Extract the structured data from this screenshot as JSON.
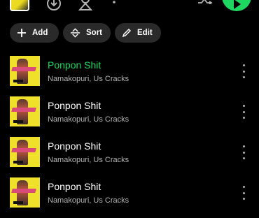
{
  "chips": {
    "add_label": "Add",
    "sort_label": "Sort",
    "edit_label": "Edit"
  },
  "tracks": [
    {
      "title": "Ponpon Shit",
      "artist": "Namakopuri, Us Cracks",
      "playing": true
    },
    {
      "title": "Ponpon Shit",
      "artist": "Namakopuri, Us Cracks",
      "playing": false
    },
    {
      "title": "Ponpon Shit",
      "artist": "Namakopuri, Us Cracks",
      "playing": false
    },
    {
      "title": "Ponpon Shit",
      "artist": "Namakopuri, Us Cracks",
      "playing": false
    }
  ],
  "colors": {
    "accent": "#1ed760",
    "chip_bg": "#2a2a2a",
    "secondary_text": "#b3b3b3",
    "background": "#000000"
  },
  "icons": [
    "download-icon",
    "person-icon",
    "more-icon",
    "shuffle-icon",
    "play-icon",
    "plus-icon",
    "sort-icon",
    "pencil-icon"
  ]
}
